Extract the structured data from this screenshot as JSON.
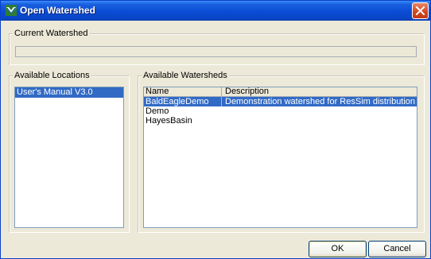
{
  "window": {
    "title": "Open Watershed"
  },
  "current_watershed": {
    "label": "Current Watershed",
    "value": ""
  },
  "locations": {
    "label": "Available Locations",
    "items": [
      {
        "label": "User's Manual V3.0",
        "selected": true
      }
    ]
  },
  "watersheds": {
    "label": "Available Watersheds",
    "columns": [
      "Name",
      "Description"
    ],
    "rows": [
      {
        "name": "BaldEagleDemo",
        "description": "Demonstration watershed for ResSim distribution",
        "selected": true
      },
      {
        "name": "Demo",
        "description": ""
      },
      {
        "name": "HayesBasin",
        "description": ""
      }
    ]
  },
  "buttons": {
    "ok": "OK",
    "cancel": "Cancel"
  },
  "colors": {
    "title_bar": "#0a4cd4",
    "selection": "#316ac5",
    "close_button": "#d2441c",
    "dialog_background": "#ece9d8"
  },
  "icons": {
    "app": "watershed-icon",
    "close": "close-icon"
  }
}
